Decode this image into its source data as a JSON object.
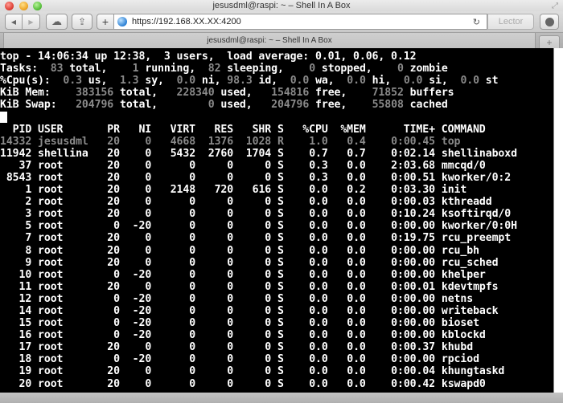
{
  "window": {
    "title": "jesusdml@raspi: ~ – Shell In A Box"
  },
  "toolbar": {
    "back_icon": "◀",
    "forward_icon": "▶",
    "cloud_icon": "☁",
    "share_icon": "⇪",
    "add_icon": "+",
    "url": "https://192.168.XX.XX:4200",
    "reload_icon": "↻",
    "reader_label": "Lector"
  },
  "tabs": [
    {
      "label": "jesusdml@raspi: ~ – Shell In A Box",
      "active": true
    }
  ],
  "newtab_icon": "+",
  "fullscreen_icon": "⤢",
  "terminal": {
    "summary": {
      "line1": "top - 14:06:34 up 12:38,  3 users,  load average: 0.01, 0.06, 0.12",
      "tasks": {
        "label": "Tasks:",
        "total": "83",
        "running": "1",
        "sleeping": "82",
        "stopped": "0",
        "zombie": "0"
      },
      "cpu": {
        "label": "%Cpu(s):",
        "us": "0.3",
        "sy": "1.3",
        "ni": "0.0",
        "id": "98.3",
        "wa": "0.0",
        "hi": "0.0",
        "si": "0.0",
        "st": "0.0"
      },
      "mem": {
        "label": "KiB Mem:",
        "total": "383156",
        "used": "228340",
        "free": "154816",
        "buffers": "71852"
      },
      "swap": {
        "label": "KiB Swap:",
        "total": "204796",
        "used": "0",
        "free": "204796",
        "cached": "55808"
      }
    },
    "columns": [
      "PID",
      "USER",
      "PR",
      "NI",
      "VIRT",
      "RES",
      "SHR",
      "S",
      "%CPU",
      "%MEM",
      "TIME+",
      "COMMAND"
    ],
    "processes": [
      {
        "pid": "14332",
        "user": "jesusdml",
        "pr": "20",
        "ni": "0",
        "virt": "4668",
        "res": "1376",
        "shr": "1028",
        "s": "R",
        "cpu": "1.0",
        "mem": "0.4",
        "time": "0:00.45",
        "command": "top",
        "dim": true
      },
      {
        "pid": "11942",
        "user": "shellina",
        "pr": "20",
        "ni": "0",
        "virt": "5432",
        "res": "2760",
        "shr": "1704",
        "s": "S",
        "cpu": "0.7",
        "mem": "0.7",
        "time": "0:02.14",
        "command": "shellinaboxd"
      },
      {
        "pid": "37",
        "user": "root",
        "pr": "20",
        "ni": "0",
        "virt": "0",
        "res": "0",
        "shr": "0",
        "s": "S",
        "cpu": "0.3",
        "mem": "0.0",
        "time": "2:03.68",
        "command": "mmcqd/0"
      },
      {
        "pid": "8543",
        "user": "root",
        "pr": "20",
        "ni": "0",
        "virt": "0",
        "res": "0",
        "shr": "0",
        "s": "S",
        "cpu": "0.3",
        "mem": "0.0",
        "time": "0:00.51",
        "command": "kworker/0:2"
      },
      {
        "pid": "1",
        "user": "root",
        "pr": "20",
        "ni": "0",
        "virt": "2148",
        "res": "720",
        "shr": "616",
        "s": "S",
        "cpu": "0.0",
        "mem": "0.2",
        "time": "0:03.30",
        "command": "init"
      },
      {
        "pid": "2",
        "user": "root",
        "pr": "20",
        "ni": "0",
        "virt": "0",
        "res": "0",
        "shr": "0",
        "s": "S",
        "cpu": "0.0",
        "mem": "0.0",
        "time": "0:00.03",
        "command": "kthreadd"
      },
      {
        "pid": "3",
        "user": "root",
        "pr": "20",
        "ni": "0",
        "virt": "0",
        "res": "0",
        "shr": "0",
        "s": "S",
        "cpu": "0.0",
        "mem": "0.0",
        "time": "0:10.24",
        "command": "ksoftirqd/0"
      },
      {
        "pid": "5",
        "user": "root",
        "pr": "0",
        "ni": "-20",
        "virt": "0",
        "res": "0",
        "shr": "0",
        "s": "S",
        "cpu": "0.0",
        "mem": "0.0",
        "time": "0:00.00",
        "command": "kworker/0:0H"
      },
      {
        "pid": "7",
        "user": "root",
        "pr": "20",
        "ni": "0",
        "virt": "0",
        "res": "0",
        "shr": "0",
        "s": "S",
        "cpu": "0.0",
        "mem": "0.0",
        "time": "0:19.75",
        "command": "rcu_preempt"
      },
      {
        "pid": "8",
        "user": "root",
        "pr": "20",
        "ni": "0",
        "virt": "0",
        "res": "0",
        "shr": "0",
        "s": "S",
        "cpu": "0.0",
        "mem": "0.0",
        "time": "0:00.00",
        "command": "rcu_bh"
      },
      {
        "pid": "9",
        "user": "root",
        "pr": "20",
        "ni": "0",
        "virt": "0",
        "res": "0",
        "shr": "0",
        "s": "S",
        "cpu": "0.0",
        "mem": "0.0",
        "time": "0:00.00",
        "command": "rcu_sched"
      },
      {
        "pid": "10",
        "user": "root",
        "pr": "0",
        "ni": "-20",
        "virt": "0",
        "res": "0",
        "shr": "0",
        "s": "S",
        "cpu": "0.0",
        "mem": "0.0",
        "time": "0:00.00",
        "command": "khelper"
      },
      {
        "pid": "11",
        "user": "root",
        "pr": "20",
        "ni": "0",
        "virt": "0",
        "res": "0",
        "shr": "0",
        "s": "S",
        "cpu": "0.0",
        "mem": "0.0",
        "time": "0:00.01",
        "command": "kdevtmpfs"
      },
      {
        "pid": "12",
        "user": "root",
        "pr": "0",
        "ni": "-20",
        "virt": "0",
        "res": "0",
        "shr": "0",
        "s": "S",
        "cpu": "0.0",
        "mem": "0.0",
        "time": "0:00.00",
        "command": "netns"
      },
      {
        "pid": "14",
        "user": "root",
        "pr": "0",
        "ni": "-20",
        "virt": "0",
        "res": "0",
        "shr": "0",
        "s": "S",
        "cpu": "0.0",
        "mem": "0.0",
        "time": "0:00.00",
        "command": "writeback"
      },
      {
        "pid": "15",
        "user": "root",
        "pr": "0",
        "ni": "-20",
        "virt": "0",
        "res": "0",
        "shr": "0",
        "s": "S",
        "cpu": "0.0",
        "mem": "0.0",
        "time": "0:00.00",
        "command": "bioset"
      },
      {
        "pid": "16",
        "user": "root",
        "pr": "0",
        "ni": "-20",
        "virt": "0",
        "res": "0",
        "shr": "0",
        "s": "S",
        "cpu": "0.0",
        "mem": "0.0",
        "time": "0:00.00",
        "command": "kblockd"
      },
      {
        "pid": "17",
        "user": "root",
        "pr": "20",
        "ni": "0",
        "virt": "0",
        "res": "0",
        "shr": "0",
        "s": "S",
        "cpu": "0.0",
        "mem": "0.0",
        "time": "0:00.37",
        "command": "khubd"
      },
      {
        "pid": "18",
        "user": "root",
        "pr": "0",
        "ni": "-20",
        "virt": "0",
        "res": "0",
        "shr": "0",
        "s": "S",
        "cpu": "0.0",
        "mem": "0.0",
        "time": "0:00.00",
        "command": "rpciod"
      },
      {
        "pid": "19",
        "user": "root",
        "pr": "20",
        "ni": "0",
        "virt": "0",
        "res": "0",
        "shr": "0",
        "s": "S",
        "cpu": "0.0",
        "mem": "0.0",
        "time": "0:00.04",
        "command": "khungtaskd"
      },
      {
        "pid": "20",
        "user": "root",
        "pr": "20",
        "ni": "0",
        "virt": "0",
        "res": "0",
        "shr": "0",
        "s": "S",
        "cpu": "0.0",
        "mem": "0.0",
        "time": "0:00.42",
        "command": "kswapd0"
      }
    ]
  }
}
